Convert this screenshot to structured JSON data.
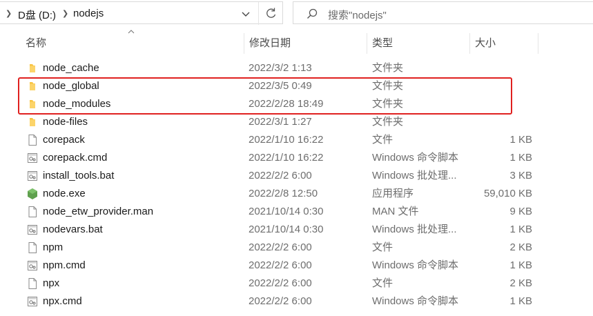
{
  "breadcrumb": {
    "items": [
      "D盘 (D:)",
      "nodejs"
    ]
  },
  "search": {
    "placeholder": "搜索\"nodejs\""
  },
  "columns": {
    "name": "名称",
    "date": "修改日期",
    "type": "类型",
    "size": "大小"
  },
  "files": [
    {
      "name": "node_cache",
      "date": "2022/3/2 1:13",
      "type": "文件夹",
      "size": "",
      "icon": "folder-icon"
    },
    {
      "name": "node_global",
      "date": "2022/3/5 0:49",
      "type": "文件夹",
      "size": "",
      "icon": "folder-icon"
    },
    {
      "name": "node_modules",
      "date": "2022/2/28 18:49",
      "type": "文件夹",
      "size": "",
      "icon": "folder-icon"
    },
    {
      "name": "node-files",
      "date": "2022/3/1 1:27",
      "type": "文件夹",
      "size": "",
      "icon": "folder-icon"
    },
    {
      "name": "corepack",
      "date": "2022/1/10 16:22",
      "type": "文件",
      "size": "1 KB",
      "icon": "file-icon"
    },
    {
      "name": "corepack.cmd",
      "date": "2022/1/10 16:22",
      "type": "Windows 命令脚本",
      "size": "1 KB",
      "icon": "script-icon"
    },
    {
      "name": "install_tools.bat",
      "date": "2022/2/2 6:00",
      "type": "Windows 批处理...",
      "size": "3 KB",
      "icon": "script-icon"
    },
    {
      "name": "node.exe",
      "date": "2022/2/8 12:50",
      "type": "应用程序",
      "size": "59,010 KB",
      "icon": "node-exe-icon"
    },
    {
      "name": "node_etw_provider.man",
      "date": "2021/10/14 0:30",
      "type": "MAN 文件",
      "size": "9 KB",
      "icon": "file-icon"
    },
    {
      "name": "nodevars.bat",
      "date": "2021/10/14 0:30",
      "type": "Windows 批处理...",
      "size": "1 KB",
      "icon": "script-icon"
    },
    {
      "name": "npm",
      "date": "2022/2/2 6:00",
      "type": "文件",
      "size": "2 KB",
      "icon": "file-icon"
    },
    {
      "name": "npm.cmd",
      "date": "2022/2/2 6:00",
      "type": "Windows 命令脚本",
      "size": "1 KB",
      "icon": "script-icon"
    },
    {
      "name": "npx",
      "date": "2022/2/2 6:00",
      "type": "文件",
      "size": "2 KB",
      "icon": "file-icon"
    },
    {
      "name": "npx.cmd",
      "date": "2022/2/2 6:00",
      "type": "Windows 命令脚本",
      "size": "1 KB",
      "icon": "script-icon"
    }
  ],
  "colors": {
    "folder": "#f8c443",
    "node_exe": "#5fa04e",
    "highlight": "#e0201f"
  }
}
